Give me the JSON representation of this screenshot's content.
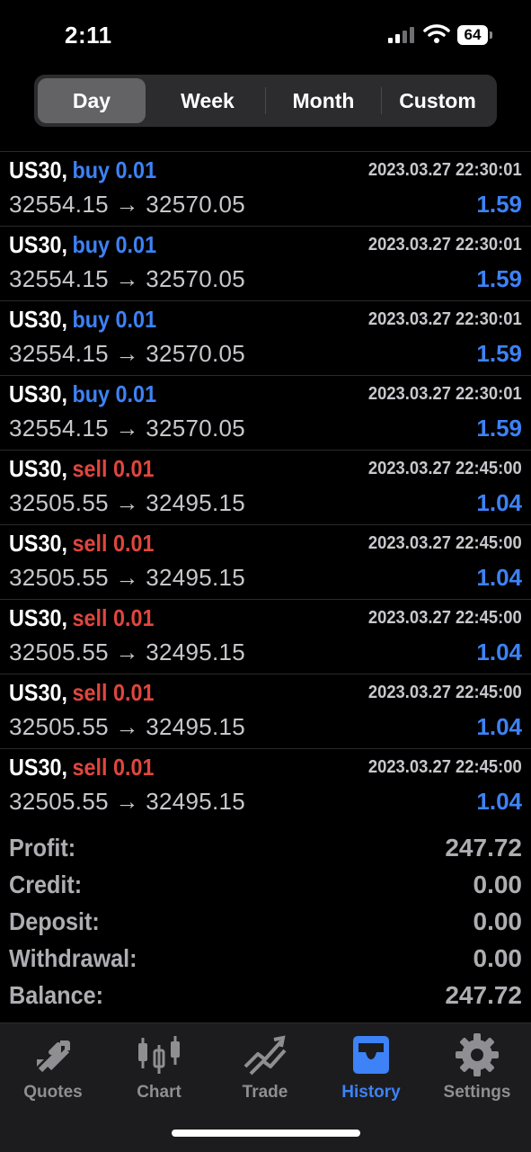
{
  "status": {
    "time": "2:11",
    "battery": "64"
  },
  "tabs": [
    "Day",
    "Week",
    "Month",
    "Custom"
  ],
  "rows": [
    {
      "symbol": "US30,",
      "action": "buy 0.01",
      "side": "buy",
      "datetime": "2023.03.27 22:30:01",
      "prices": "32554.15 → 32570.05",
      "profit": "1.59"
    },
    {
      "symbol": "US30,",
      "action": "buy 0.01",
      "side": "buy",
      "datetime": "2023.03.27 22:30:01",
      "prices": "32554.15 → 32570.05",
      "profit": "1.59"
    },
    {
      "symbol": "US30,",
      "action": "buy 0.01",
      "side": "buy",
      "datetime": "2023.03.27 22:30:01",
      "prices": "32554.15 → 32570.05",
      "profit": "1.59"
    },
    {
      "symbol": "US30,",
      "action": "buy 0.01",
      "side": "buy",
      "datetime": "2023.03.27 22:30:01",
      "prices": "32554.15 → 32570.05",
      "profit": "1.59"
    },
    {
      "symbol": "US30,",
      "action": "sell 0.01",
      "side": "sell",
      "datetime": "2023.03.27 22:45:00",
      "prices": "32505.55 → 32495.15",
      "profit": "1.04"
    },
    {
      "symbol": "US30,",
      "action": "sell 0.01",
      "side": "sell",
      "datetime": "2023.03.27 22:45:00",
      "prices": "32505.55 → 32495.15",
      "profit": "1.04"
    },
    {
      "symbol": "US30,",
      "action": "sell 0.01",
      "side": "sell",
      "datetime": "2023.03.27 22:45:00",
      "prices": "32505.55 → 32495.15",
      "profit": "1.04"
    },
    {
      "symbol": "US30,",
      "action": "sell 0.01",
      "side": "sell",
      "datetime": "2023.03.27 22:45:00",
      "prices": "32505.55 → 32495.15",
      "profit": "1.04"
    },
    {
      "symbol": "US30,",
      "action": "sell 0.01",
      "side": "sell",
      "datetime": "2023.03.27 22:45:00",
      "prices": "32505.55 → 32495.15",
      "profit": "1.04"
    }
  ],
  "summary": [
    {
      "label": "Profit:",
      "value": "247.72"
    },
    {
      "label": "Credit:",
      "value": "0.00"
    },
    {
      "label": "Deposit:",
      "value": "0.00"
    },
    {
      "label": "Withdrawal:",
      "value": "0.00"
    },
    {
      "label": "Balance:",
      "value": "247.72"
    }
  ],
  "tabbar": [
    {
      "label": "Quotes",
      "icon": "quotes-arrows-icon"
    },
    {
      "label": "Chart",
      "icon": "candlestick-chart-icon"
    },
    {
      "label": "Trade",
      "icon": "trade-trend-icon"
    },
    {
      "label": "History",
      "icon": "history-tray-icon"
    },
    {
      "label": "Settings",
      "icon": "gear-icon"
    }
  ],
  "colors": {
    "buy": "#3d82f6",
    "sell": "#e0463e",
    "accent": "#3d82f6",
    "background": "#000000"
  }
}
